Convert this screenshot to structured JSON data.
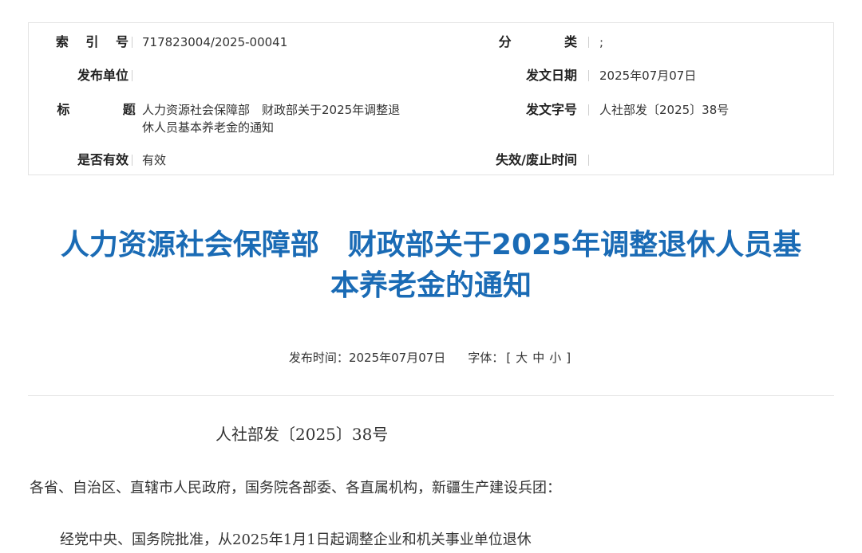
{
  "meta": {
    "index_label": "索 引 号",
    "index_value": "717823004/2025-00041",
    "category_label": "分 类",
    "category_value": ";",
    "publisher_label": "发布单位",
    "publisher_value": "",
    "issue_date_label": "发文日期",
    "issue_date_value": "2025年07月07日",
    "title_label": "标 题",
    "title_value": "人力资源社会保障部　财政部关于2025年调整退休人员基本养老金的通知",
    "doc_no_label": "发文字号",
    "doc_no_value": "人社部发〔2025〕38号",
    "valid_label": "是否有效",
    "valid_value": "有效",
    "expiry_label": "失效/废止时间",
    "expiry_value": ""
  },
  "title": {
    "line1": "人力资源社会保障部　财政部关于2025年调整退休人员基",
    "line2": "本养老金的通知"
  },
  "pub_info": {
    "time_label": "发布时间：",
    "time_value": "2025年07月07日",
    "font_label": "字体：",
    "bracket_open": "[",
    "large": "大",
    "medium": "中",
    "small": "小",
    "bracket_close": "]"
  },
  "body": {
    "doc_number": "人社部发〔2025〕38号",
    "addressee": "各省、自治区、直辖市人民政府，国务院各部委、各直属机构，新疆生产建设兵团：",
    "paragraph1": "经党中央、国务院批准，从2025年1月1日起调整企业和机关事业单位退休"
  },
  "colors": {
    "title_blue": "#1a6bb5",
    "border_gray": "#e3e3e3"
  }
}
